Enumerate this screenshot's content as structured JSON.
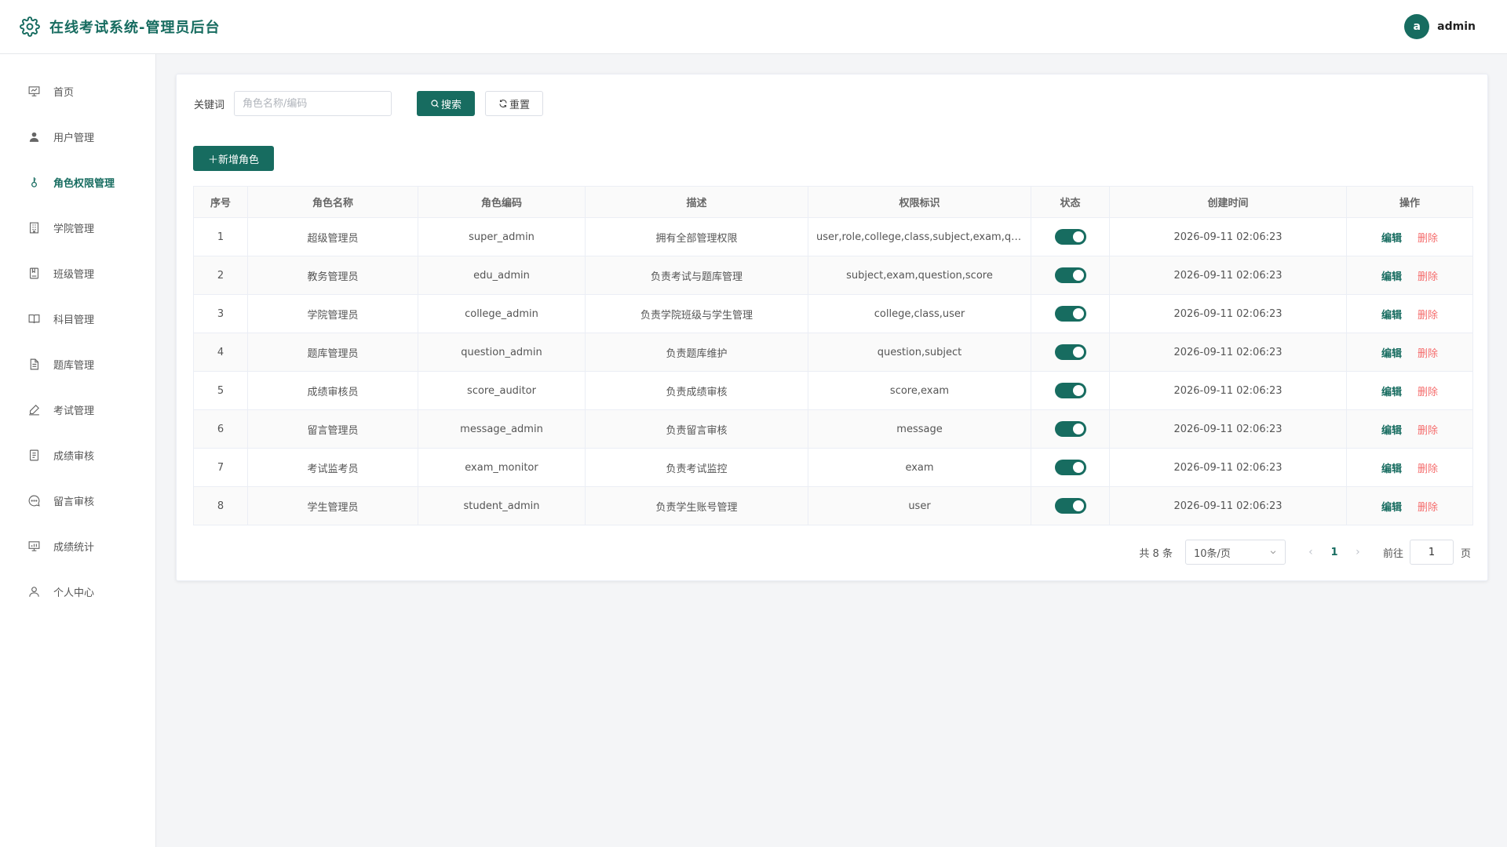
{
  "header": {
    "title": "在线考试系统-管理员后台",
    "avatar_letter": "a",
    "username": "admin"
  },
  "sidebar": {
    "items": [
      {
        "label": "首页",
        "icon": "dashboard-icon"
      },
      {
        "label": "用户管理",
        "icon": "user-icon"
      },
      {
        "label": "角色权限管理",
        "icon": "key-icon"
      },
      {
        "label": "学院管理",
        "icon": "building-icon"
      },
      {
        "label": "班级管理",
        "icon": "notebook-icon"
      },
      {
        "label": "科目管理",
        "icon": "book-icon"
      },
      {
        "label": "题库管理",
        "icon": "document-icon"
      },
      {
        "label": "考试管理",
        "icon": "pen-icon"
      },
      {
        "label": "成绩审核",
        "icon": "list-icon"
      },
      {
        "label": "留言审核",
        "icon": "chat-icon"
      },
      {
        "label": "成绩统计",
        "icon": "chart-icon"
      },
      {
        "label": "个人中心",
        "icon": "profile-icon"
      }
    ],
    "active_index": 2
  },
  "search": {
    "label": "关键词",
    "placeholder": "角色名称/编码",
    "value": "",
    "search_button": "搜索",
    "reset_button": "重置"
  },
  "add_button": "新增角色",
  "table": {
    "columns": [
      "序号",
      "角色名称",
      "角色编码",
      "描述",
      "权限标识",
      "状态",
      "创建时间",
      "操作"
    ],
    "rows": [
      {
        "no": "1",
        "name": "超级管理员",
        "code": "super_admin",
        "desc": "拥有全部管理权限",
        "perms": "user,role,college,class,subject,exam,qu…",
        "enabled": true,
        "created": "2026-09-11 02:06:23"
      },
      {
        "no": "2",
        "name": "教务管理员",
        "code": "edu_admin",
        "desc": "负责考试与题库管理",
        "perms": "subject,exam,question,score",
        "enabled": true,
        "created": "2026-09-11 02:06:23"
      },
      {
        "no": "3",
        "name": "学院管理员",
        "code": "college_admin",
        "desc": "负责学院班级与学生管理",
        "perms": "college,class,user",
        "enabled": true,
        "created": "2026-09-11 02:06:23"
      },
      {
        "no": "4",
        "name": "题库管理员",
        "code": "question_admin",
        "desc": "负责题库维护",
        "perms": "question,subject",
        "enabled": true,
        "created": "2026-09-11 02:06:23"
      },
      {
        "no": "5",
        "name": "成绩审核员",
        "code": "score_auditor",
        "desc": "负责成绩审核",
        "perms": "score,exam",
        "enabled": true,
        "created": "2026-09-11 02:06:23"
      },
      {
        "no": "6",
        "name": "留言管理员",
        "code": "message_admin",
        "desc": "负责留言审核",
        "perms": "message",
        "enabled": true,
        "created": "2026-09-11 02:06:23"
      },
      {
        "no": "7",
        "name": "考试监考员",
        "code": "exam_monitor",
        "desc": "负责考试监控",
        "perms": "exam",
        "enabled": true,
        "created": "2026-09-11 02:06:23"
      },
      {
        "no": "8",
        "name": "学生管理员",
        "code": "student_admin",
        "desc": "负责学生账号管理",
        "perms": "user",
        "enabled": true,
        "created": "2026-09-11 02:06:23"
      }
    ],
    "edit_label": "编辑",
    "delete_label": "删除"
  },
  "pagination": {
    "total_text": "共 8 条",
    "page_size": "10条/页",
    "current_page": "1",
    "goto_label": "前往",
    "goto_value": "1",
    "page_suffix": "页",
    "prev_arrow": "‹",
    "next_arrow": "›"
  },
  "colors": {
    "primary": "#176c60",
    "danger": "#f56c6c"
  }
}
